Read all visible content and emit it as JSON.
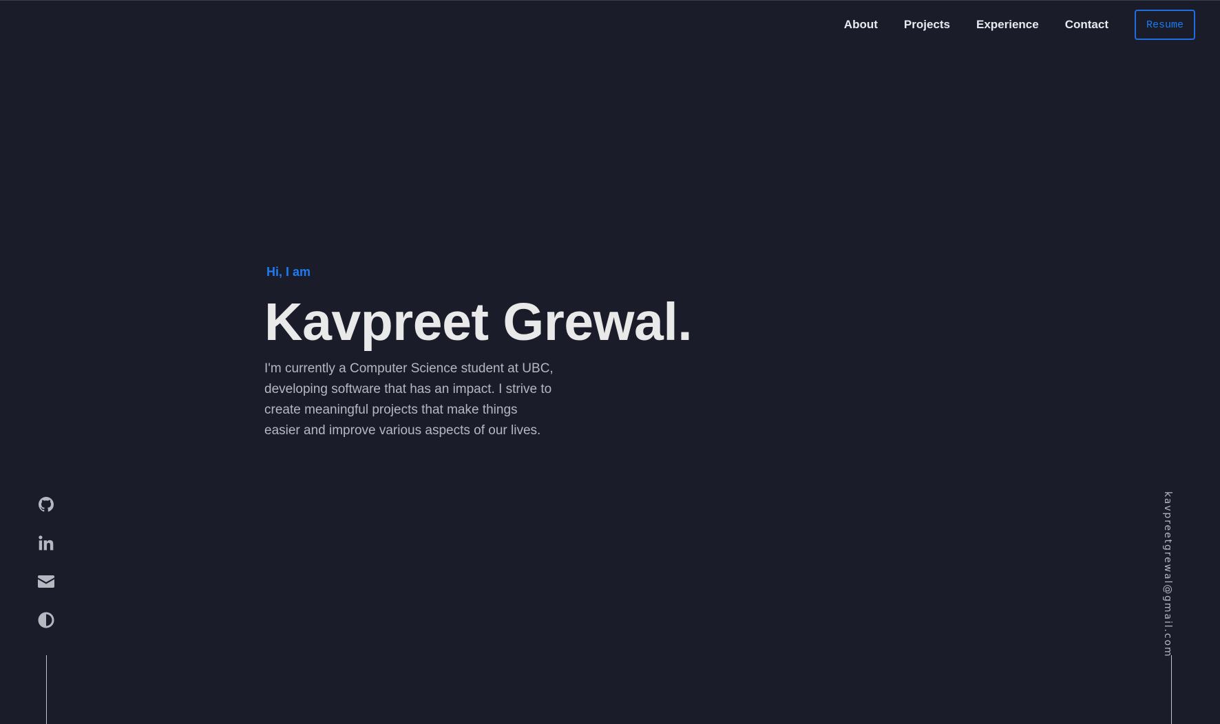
{
  "nav": {
    "links": [
      {
        "label": "About"
      },
      {
        "label": "Projects"
      },
      {
        "label": "Experience"
      },
      {
        "label": "Contact"
      }
    ],
    "resume_label": "Resume"
  },
  "hero": {
    "greeting": "Hi, I am",
    "name": "Kavpreet Grewal.",
    "bio": "I'm currently a Computer Science student at UBC, developing software that has an impact. I strive to create meaningful projects that make things easier and improve various aspects of our lives."
  },
  "social": {
    "icons": [
      "github-icon",
      "linkedin-icon",
      "email-icon",
      "theme-toggle-icon"
    ]
  },
  "email": "kavpreetgrewal@gmail.com",
  "colors": {
    "background": "#1a1d29",
    "accent": "#1f7bf0",
    "heading": "#e9e9ea",
    "body_text": "#b5b8c1"
  }
}
